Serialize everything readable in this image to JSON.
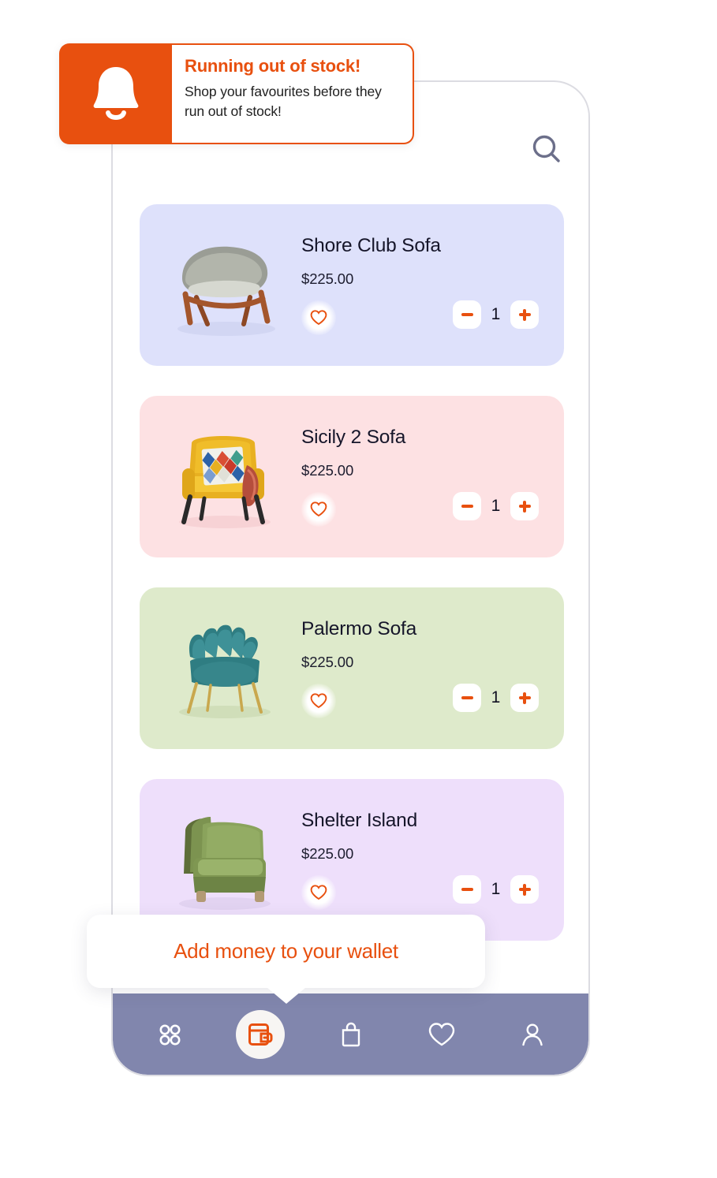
{
  "notification": {
    "icon": "bell-icon",
    "title": "Running out of stock!",
    "subtitle": "Shop your favourites before they run out of stock!",
    "accent_color": "#E8500F"
  },
  "header": {
    "search_icon": "search-icon"
  },
  "products": [
    {
      "name": "Shore Club Sofa",
      "price": "$225.00",
      "quantity": "1",
      "card_color": "#DEE1FB",
      "image": "grey-lounge-chair",
      "favorite_icon": "heart-icon",
      "decrement_label": "−",
      "increment_label": "+"
    },
    {
      "name": "Sicily 2 Sofa",
      "price": "$225.00",
      "quantity": "1",
      "card_color": "#FDE1E3",
      "image": "yellow-armchair-with-pillow",
      "favorite_icon": "heart-icon",
      "decrement_label": "−",
      "increment_label": "+"
    },
    {
      "name": "Palermo Sofa",
      "price": "$225.00",
      "quantity": "1",
      "card_color": "#DEEACB",
      "image": "teal-shell-chair",
      "favorite_icon": "heart-icon",
      "decrement_label": "−",
      "increment_label": "+"
    },
    {
      "name": "Shelter Island",
      "price": "$225.00",
      "quantity": "1",
      "card_color": "#EEDFFB",
      "image": "green-shelter-armchair",
      "favorite_icon": "heart-icon",
      "decrement_label": "−",
      "increment_label": "+"
    }
  ],
  "wallet_tooltip": {
    "label": "Add money to your wallet"
  },
  "bottom_nav": {
    "background_color": "#8186AD",
    "active_color": "#E8500F",
    "items": [
      {
        "icon": "grid-icon",
        "active": false
      },
      {
        "icon": "wallet-icon",
        "active": true
      },
      {
        "icon": "shopping-bag-icon",
        "active": false
      },
      {
        "icon": "heart-icon",
        "active": false
      },
      {
        "icon": "person-icon",
        "active": false
      }
    ]
  }
}
